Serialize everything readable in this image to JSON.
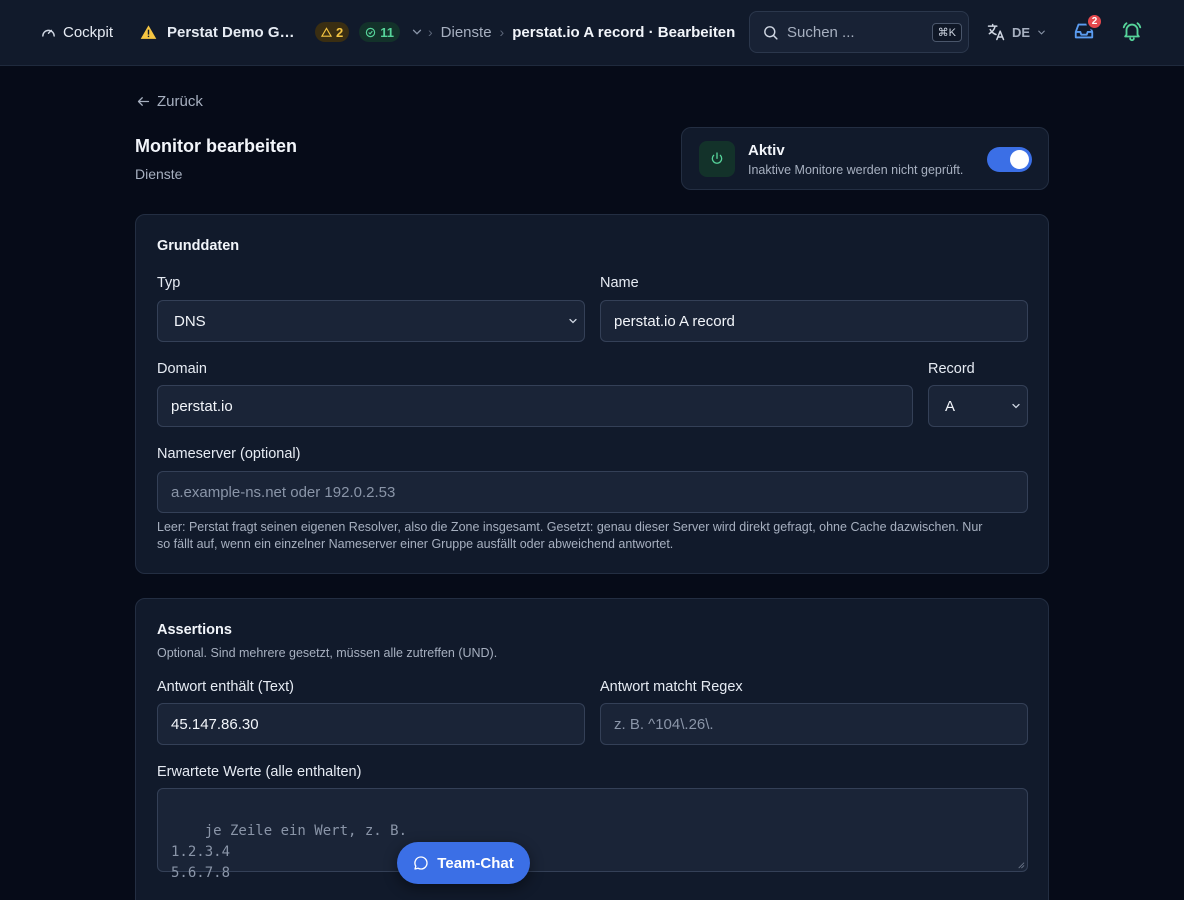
{
  "colors": {
    "background": "#060b18",
    "card": "#111a2b",
    "accent": "#3b6fe6",
    "success": "#56d39a",
    "warning": "#f5c542",
    "danger": "#e5484d"
  },
  "topbar": {
    "cockpit_label": "Cockpit",
    "cockpit_icon": "gauge-icon",
    "org_warning_icon": "warning-triangle-icon",
    "org_name": "Perstat Demo GmbH",
    "warning_count": "2",
    "ok_count": "11",
    "breadcrumb": [
      {
        "label": "Dienste"
      },
      {
        "label": "perstat.io A record · Bearbeiten"
      }
    ],
    "search_placeholder": "Suchen ...",
    "search_shortcut": "⌘K",
    "language": "DE",
    "inbox_count": "2"
  },
  "page": {
    "back_label": "Zurück",
    "title": "Monitor bearbeiten",
    "subtitle": "Dienste",
    "active_label": "Aktiv",
    "active_hint": "Inaktive Monitore werden nicht geprüft.",
    "active": true
  },
  "basics": {
    "section_title": "Grunddaten",
    "type_label": "Typ",
    "type_value": "DNS",
    "name_label": "Name",
    "name_value": "perstat.io A record",
    "domain_label": "Domain",
    "domain_value": "perstat.io",
    "record_label": "Record",
    "record_value": "A",
    "nameserver_label": "Nameserver (optional)",
    "nameserver_placeholder": "a.example-ns.net oder 192.0.2.53",
    "nameserver_help_line1": "Leer: Perstat fragt seinen eigenen Resolver, also die Zone insgesamt. Gesetzt: genau dieser Server wird direkt gefragt, ohne Cache dazwischen. Nur",
    "nameserver_help_line2": "so fällt auf, wenn ein einzelner Nameserver einer Gruppe ausfällt oder abweichend antwortet."
  },
  "assertions": {
    "section_title": "Assertions",
    "description": "Optional. Sind mehrere gesetzt, müssen alle zutreffen (UND).",
    "contains_label": "Antwort enthält (Text)",
    "contains_value": "45.147.86.30",
    "regex_label": "Antwort matcht Regex",
    "regex_placeholder": "z. B. ^104\\.26\\.",
    "expected_label": "Erwartete Werte (alle enthalten)",
    "expected_placeholder": "je Zeile ein Wert, z. B.\n1.2.3.4\n5.6.7.8"
  },
  "chat": {
    "label": "Team-Chat"
  }
}
